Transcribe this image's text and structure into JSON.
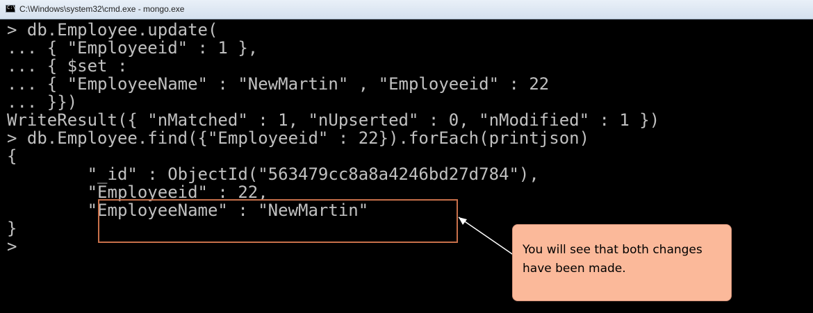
{
  "window": {
    "title": "C:\\Windows\\system32\\cmd.exe - mongo.exe",
    "icon": "console-icon"
  },
  "console": {
    "lines": [
      "> db.Employee.update(",
      "... { \"Employeeid\" : 1 },",
      "... { $set :",
      "... { \"EmployeeName\" : \"NewMartin\" , \"Employeeid\" : 22",
      "... }})",
      "WriteResult({ \"nMatched\" : 1, \"nUpserted\" : 0, \"nModified\" : 1 })",
      "> db.Employee.find({\"Employeeid\" : 22}).forEach(printjson)",
      "{",
      "        \"_id\" : ObjectId(\"563479cc8a8a4246bd27d784\"),",
      "        \"Employeeid\" : 22,",
      "        \"EmployeeName\" : \"NewMartin\"",
      "}",
      ">"
    ]
  },
  "callout": {
    "text": "You will see that both changes have been made."
  },
  "colors": {
    "console_bg": "#000000",
    "console_text": "#c0c0c0",
    "highlight_border": "#c8704a",
    "callout_bg": "#fbb99a"
  }
}
